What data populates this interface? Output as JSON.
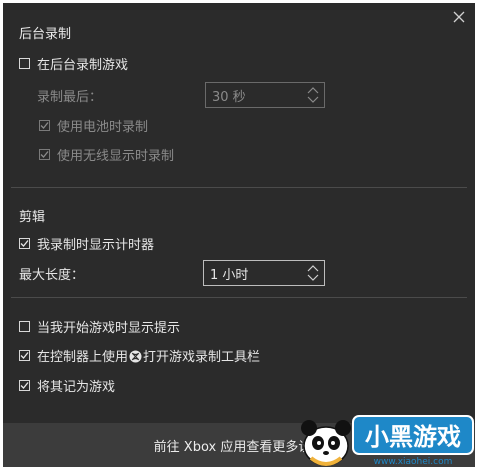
{
  "background_recording": {
    "title": "后台录制",
    "record_in_background": {
      "label": "在后台录制游戏",
      "checked": false
    },
    "record_last_label": "录制最后：",
    "record_last_value": "30 秒",
    "use_battery": {
      "label": "使用电池时录制",
      "checked": true,
      "disabled": true
    },
    "use_wireless_display": {
      "label": "使用无线显示时录制",
      "checked": true,
      "disabled": true
    }
  },
  "clips": {
    "title": "剪辑",
    "show_timer": {
      "label": "我录制时显示计时器",
      "checked": true
    },
    "max_length_label": "最大长度：",
    "max_length_value": "1 小时"
  },
  "misc": {
    "show_tips": {
      "label": "当我开始游戏时显示提示",
      "checked": false
    },
    "controller_open_prefix": "在控制器上使用",
    "controller_open_suffix": "打开游戏录制工具栏",
    "controller_open_checked": true,
    "remember_game": {
      "label": "将其记为游戏",
      "checked": true
    }
  },
  "footer": {
    "link_text": "前往 Xbox 应用查看更多设置"
  },
  "watermark": {
    "brand": "小黑游戏",
    "url": "www.xiaohei.com"
  },
  "icons": {
    "close": "close-icon",
    "xbox": "xbox-button-icon",
    "spinner": "up-down-arrows-icon"
  }
}
